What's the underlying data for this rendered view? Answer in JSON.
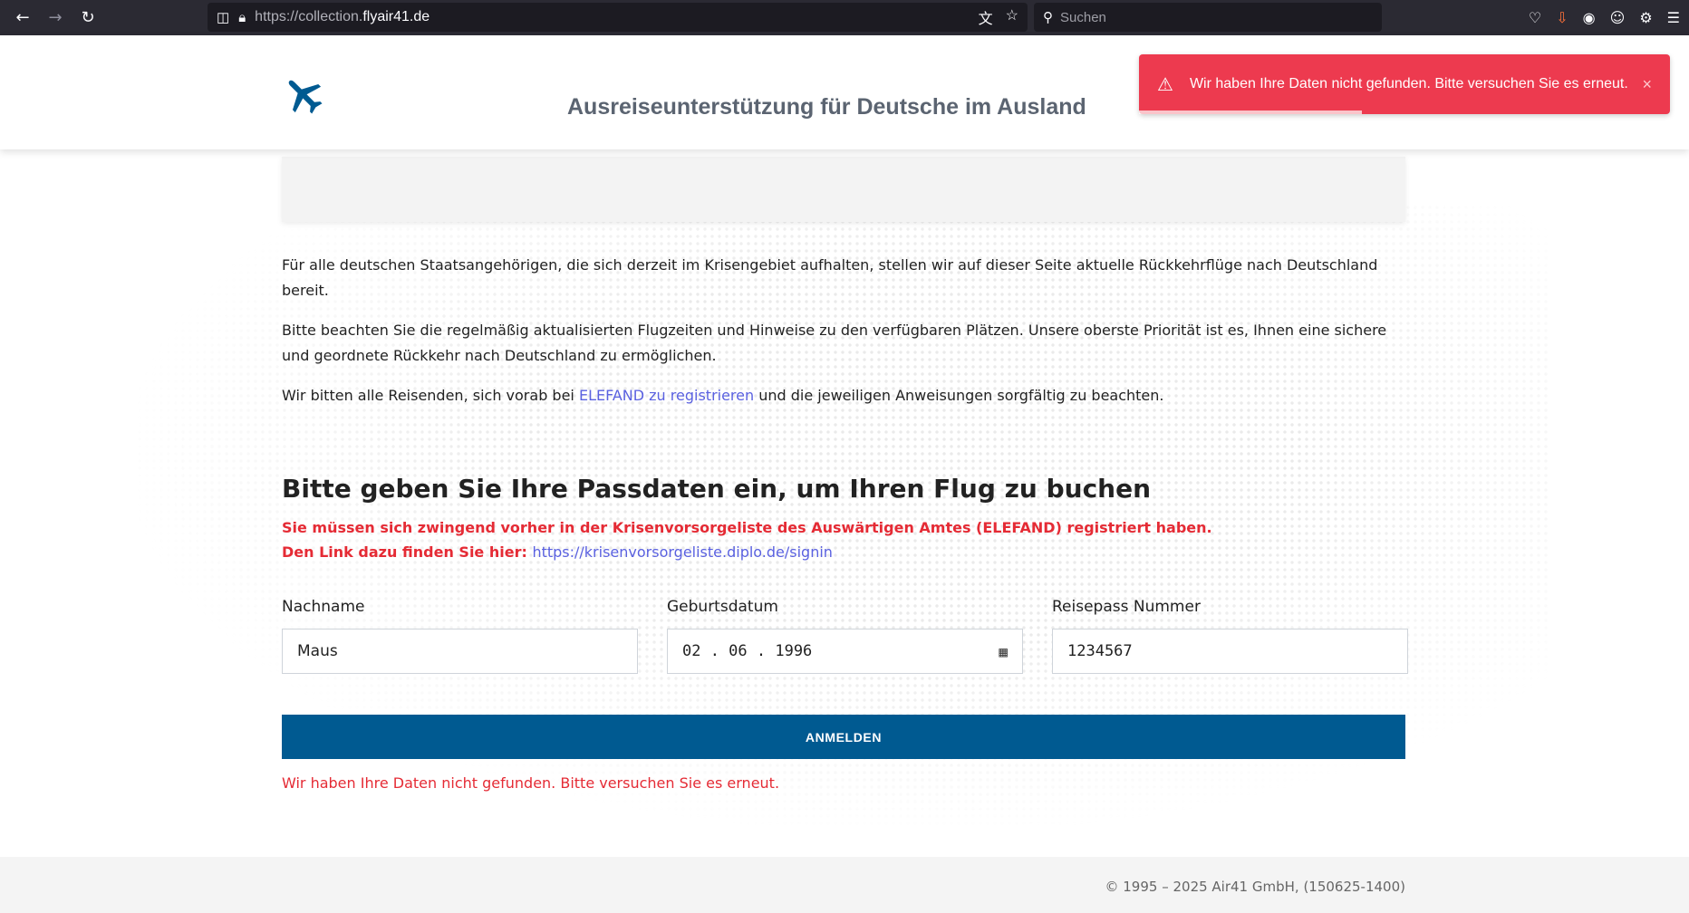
{
  "browser": {
    "back_icon": "arrow-left-icon",
    "forward_icon": "arrow-right-icon",
    "reload_icon": "reload-icon",
    "url_prefix": "https://collection.",
    "url_domain": "flyair41.de",
    "search_placeholder": "Suchen"
  },
  "header": {
    "title": "Ausreiseunterstützung für Deutsche im Ausland",
    "logo_icon": "airplane-icon"
  },
  "toast": {
    "message": "Wir haben Ihre Daten nicht gefunden. Bitte versuchen Sie es erneut.",
    "close_label": "×",
    "progress": 0.42,
    "color": "#ed3a4f"
  },
  "intro": {
    "p1": "Für alle deutschen Staatsangehörigen, die sich derzeit im Krisengebiet aufhalten, stellen wir auf dieser Seite aktuelle Rückkehrflüge nach Deutschland bereit.",
    "p2": "Bitte beachten Sie die regelmäßig aktualisierten Flugzeiten und Hinweise zu den verfügbaren Plätzen. Unsere oberste Priorität ist es, Ihnen eine sichere und geordnete Rückkehr nach Deutschland zu ermöglichen.",
    "p3_before": "Wir bitten alle Reisenden, sich vorab bei ",
    "p3_link": "ELEFAND zu registrieren",
    "p3_after": " und die jeweiligen Anweisungen sorgfältig zu beachten."
  },
  "form": {
    "heading": "Bitte geben Sie Ihre Passdaten ein, um Ihren Flug zu buchen",
    "warning_line1": "Sie müssen sich zwingend vorher in der Krisenvorsorgeliste des Auswärtigen Amtes (ELEFAND) registriert haben.",
    "warning_line2": "Den Link dazu finden Sie hier: ",
    "warning_link": "https://krisenvorsorgeliste.diplo.de/signin",
    "lastname_label": "Nachname",
    "lastname_value": "Maus",
    "birthdate_label": "Geburtsdatum",
    "birthdate_value": "02 . 06 . 1996",
    "passport_label": "Reisepass Nummer",
    "passport_value": "1234567",
    "submit_label": "ANMELDEN",
    "error": "Wir haben Ihre Daten nicht gefunden. Bitte versuchen Sie es erneut."
  },
  "footer": {
    "copyright": "© 1995 – 2025 Air41 GmbH, (150625-1400)"
  },
  "colors": {
    "brand": "#005a91",
    "error": "#e52b35",
    "link": "#5a61e0"
  }
}
